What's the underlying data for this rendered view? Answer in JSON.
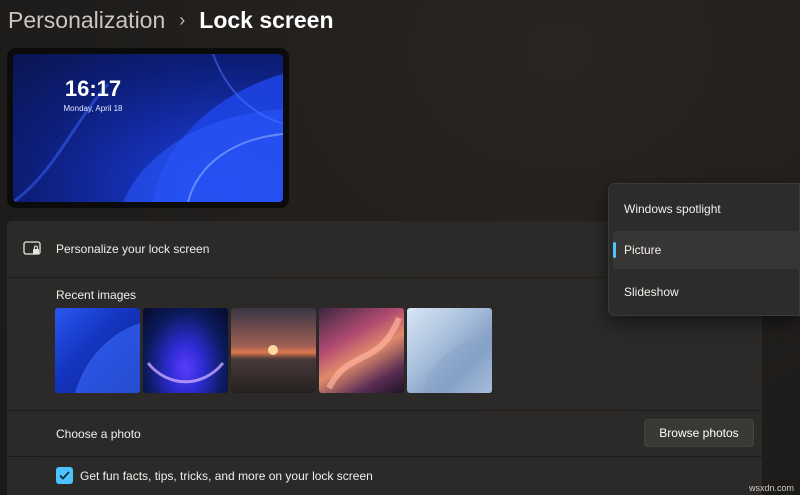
{
  "breadcrumb": {
    "parent": "Personalization",
    "separator": "›",
    "current": "Lock screen"
  },
  "preview": {
    "time": "16:17",
    "date": "Monday, April 18"
  },
  "personalize": {
    "icon": "lock-screen-icon",
    "label": "Personalize your lock screen"
  },
  "recent_images": {
    "label": "Recent images",
    "items": [
      "Blue bloom",
      "Blue glow",
      "Sunset lake",
      "Pink ribbon",
      "Silver bloom"
    ]
  },
  "choose_photo": {
    "label": "Choose a photo",
    "button_label": "Browse photos"
  },
  "fun_facts": {
    "label": "Get fun facts, tips, tricks, and more on your lock screen",
    "checked": true
  },
  "dropdown": {
    "items": [
      "Windows spotlight",
      "Picture",
      "Slideshow"
    ],
    "selected": "Picture"
  },
  "watermark": "wsxdn.com",
  "colors": {
    "accent": "#4cc2ff",
    "background": "#211f1d",
    "card": "#2b2a28"
  }
}
